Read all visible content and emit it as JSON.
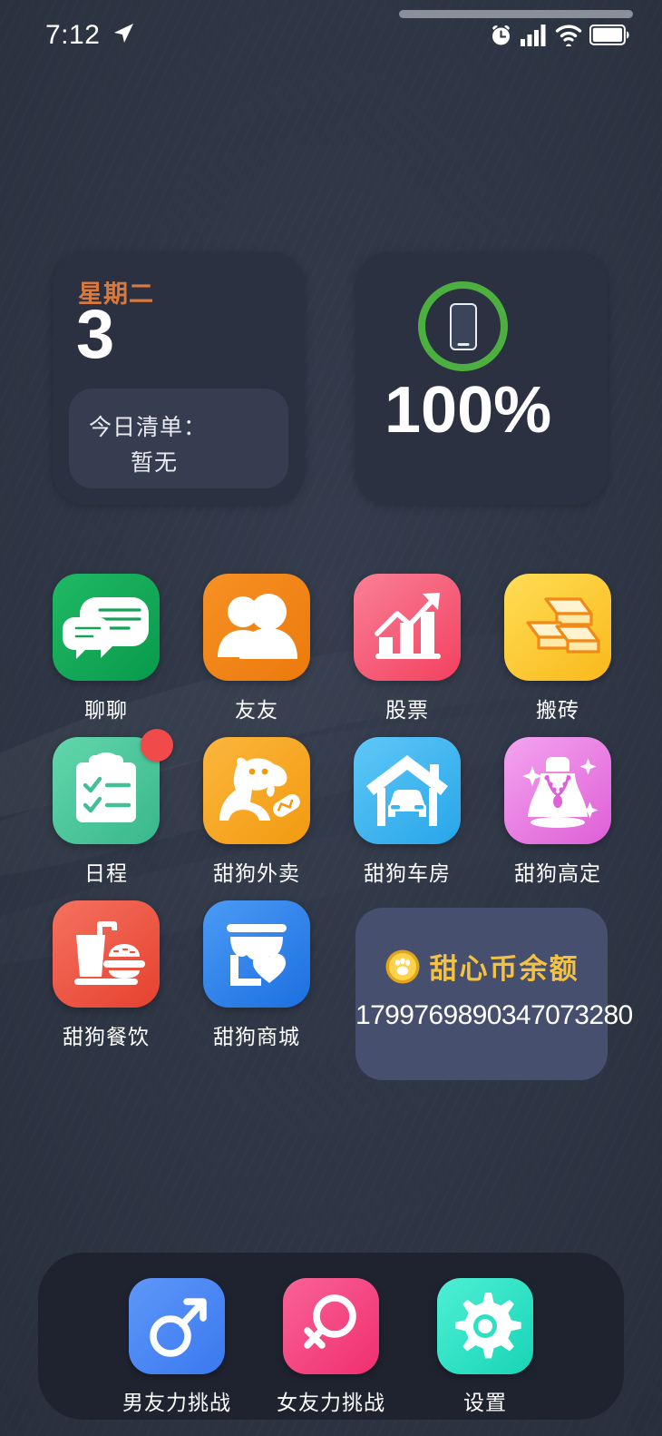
{
  "status_bar": {
    "time": "7:12",
    "icons": [
      "location-arrow-icon",
      "alarm-clock-icon",
      "signal-bars-icon",
      "wifi-icon",
      "battery-icon"
    ]
  },
  "widgets": {
    "calendar": {
      "weekday": "星期二",
      "day": "3",
      "list_title": "今日清单：",
      "list_value": "暂无",
      "weekday_color": "#d9793d"
    },
    "battery": {
      "percent": "100%",
      "ring_color": "#4caf3f",
      "icon": "phone-icon"
    },
    "coin": {
      "title": "甜心币余额",
      "value": "1799769890347073280",
      "title_color": "#f3c243",
      "icon": "paw-coin-icon",
      "background": "#464f6e"
    }
  },
  "apps": [
    [
      {
        "label": "聊聊",
        "icon": "chat-bubbles-icon",
        "color": "#18a558",
        "badge": false
      },
      {
        "label": "友友",
        "icon": "people-icon",
        "color": "#f08419",
        "badge": false
      },
      {
        "label": "股票",
        "icon": "growth-chart-icon",
        "color": "#f45a78",
        "badge": false
      },
      {
        "label": "搬砖",
        "icon": "gold-bars-icon",
        "color": "#fbc52d",
        "badge": false
      }
    ],
    [
      {
        "label": "日程",
        "icon": "clipboard-checklist-icon",
        "color": "#4cc69a",
        "badge": true
      },
      {
        "label": "甜狗外卖",
        "icon": "dog-delivery-icon",
        "color": "#f5a623",
        "badge": false
      },
      {
        "label": "甜狗车房",
        "icon": "house-car-icon",
        "color": "#3fb3ef",
        "badge": false
      },
      {
        "label": "甜狗高定",
        "icon": "necklace-icon",
        "color": "#e87ae0",
        "badge": false
      }
    ],
    [
      {
        "label": "甜狗餐饮",
        "icon": "drink-burger-icon",
        "color": "#ef5b4c",
        "badge": false
      },
      {
        "label": "甜狗商城",
        "icon": "storefront-heart-icon",
        "color": "#2c83f0",
        "badge": false
      }
    ]
  ],
  "dock": [
    {
      "label": "男友力挑战",
      "icon": "male-symbol-icon",
      "color": "#4a86f7"
    },
    {
      "label": "女友力挑战",
      "icon": "female-symbol-icon",
      "color": "#f5partial"
    },
    {
      "label": "设置",
      "icon": "gear-icon",
      "color": "#2fe0c4"
    }
  ],
  "dock_colors": [
    "#4a86f7",
    "#f54b87",
    "#2fe0c4"
  ],
  "background_color": "#343c4d"
}
